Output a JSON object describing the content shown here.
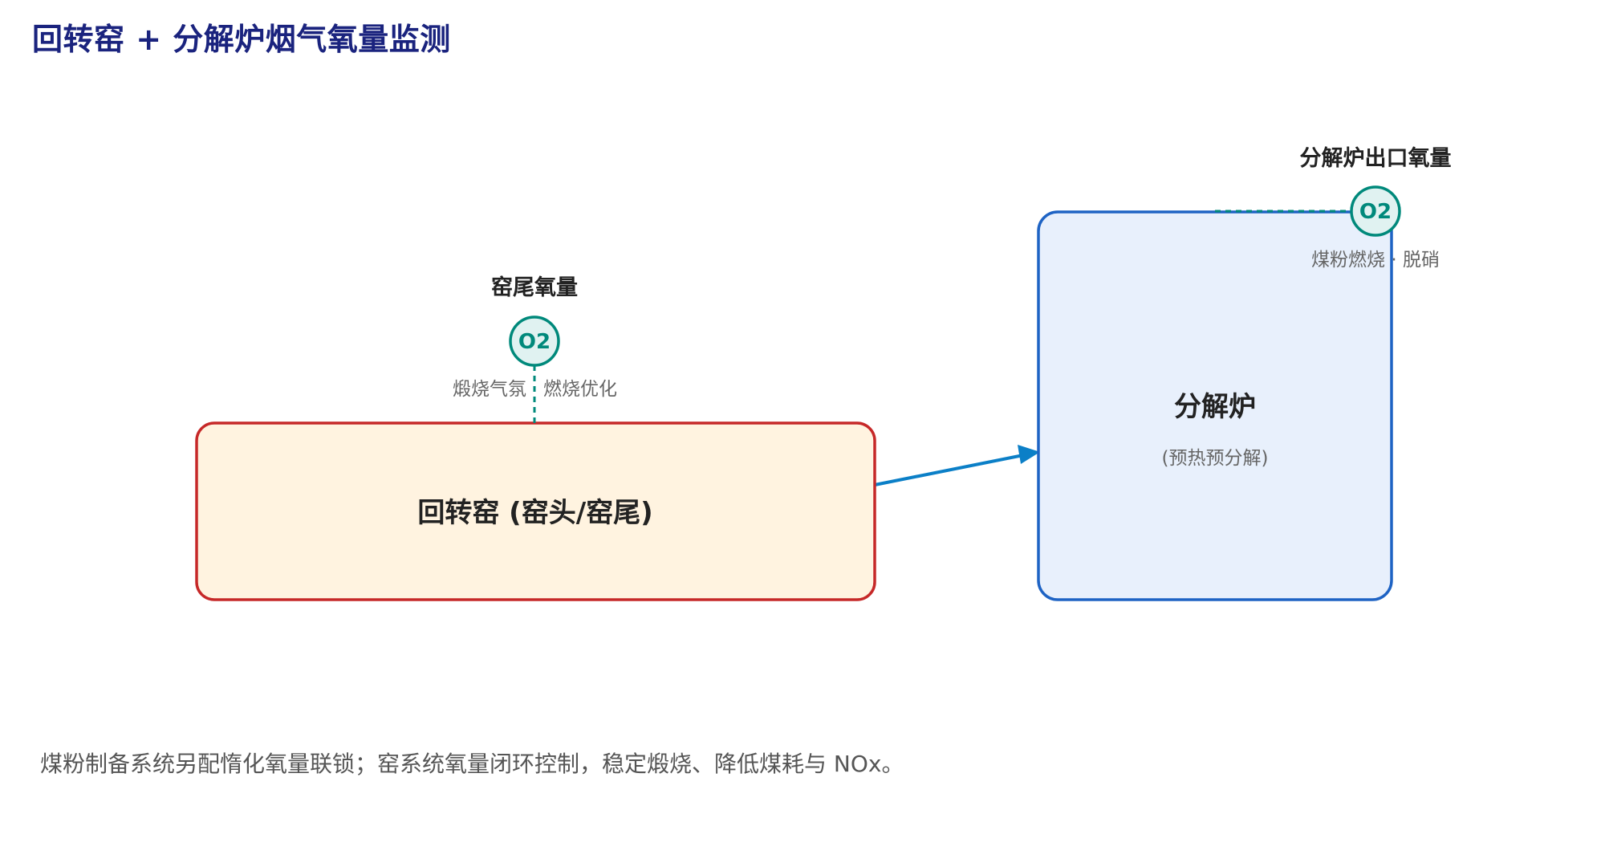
{
  "page": {
    "title": "回转窑 + 分解炉烟气氧量监测",
    "footnote": "煤粉制备系统另配惰化氧量联锁；窑系统氧量闭环控制，稳定煅烧、降低煤耗与 NOx。"
  },
  "nodes": {
    "kiln": {
      "label": "回转窑 (窑头/窑尾)",
      "fill": "#fff3e0",
      "stroke": "#c62828"
    },
    "calciner": {
      "label": "分解炉",
      "sublabel": "(预热预分解)",
      "fill": "#e8f0fc",
      "stroke": "#1e63c4"
    }
  },
  "sensors": {
    "kiln_tail": {
      "label": "窑尾氧量",
      "tag": "O2",
      "note_left": "煅烧气氛",
      "note_right": "燃烧优化"
    },
    "calciner_outlet": {
      "label": "分解炉出口氧量",
      "tag": "O2",
      "note": "煤粉燃烧 · 脱硝"
    }
  },
  "colors": {
    "title": "#1a237e",
    "sensor": "#00897b",
    "sensor_fill": "#e0f2f1",
    "arrow": "#0b7fc7"
  }
}
